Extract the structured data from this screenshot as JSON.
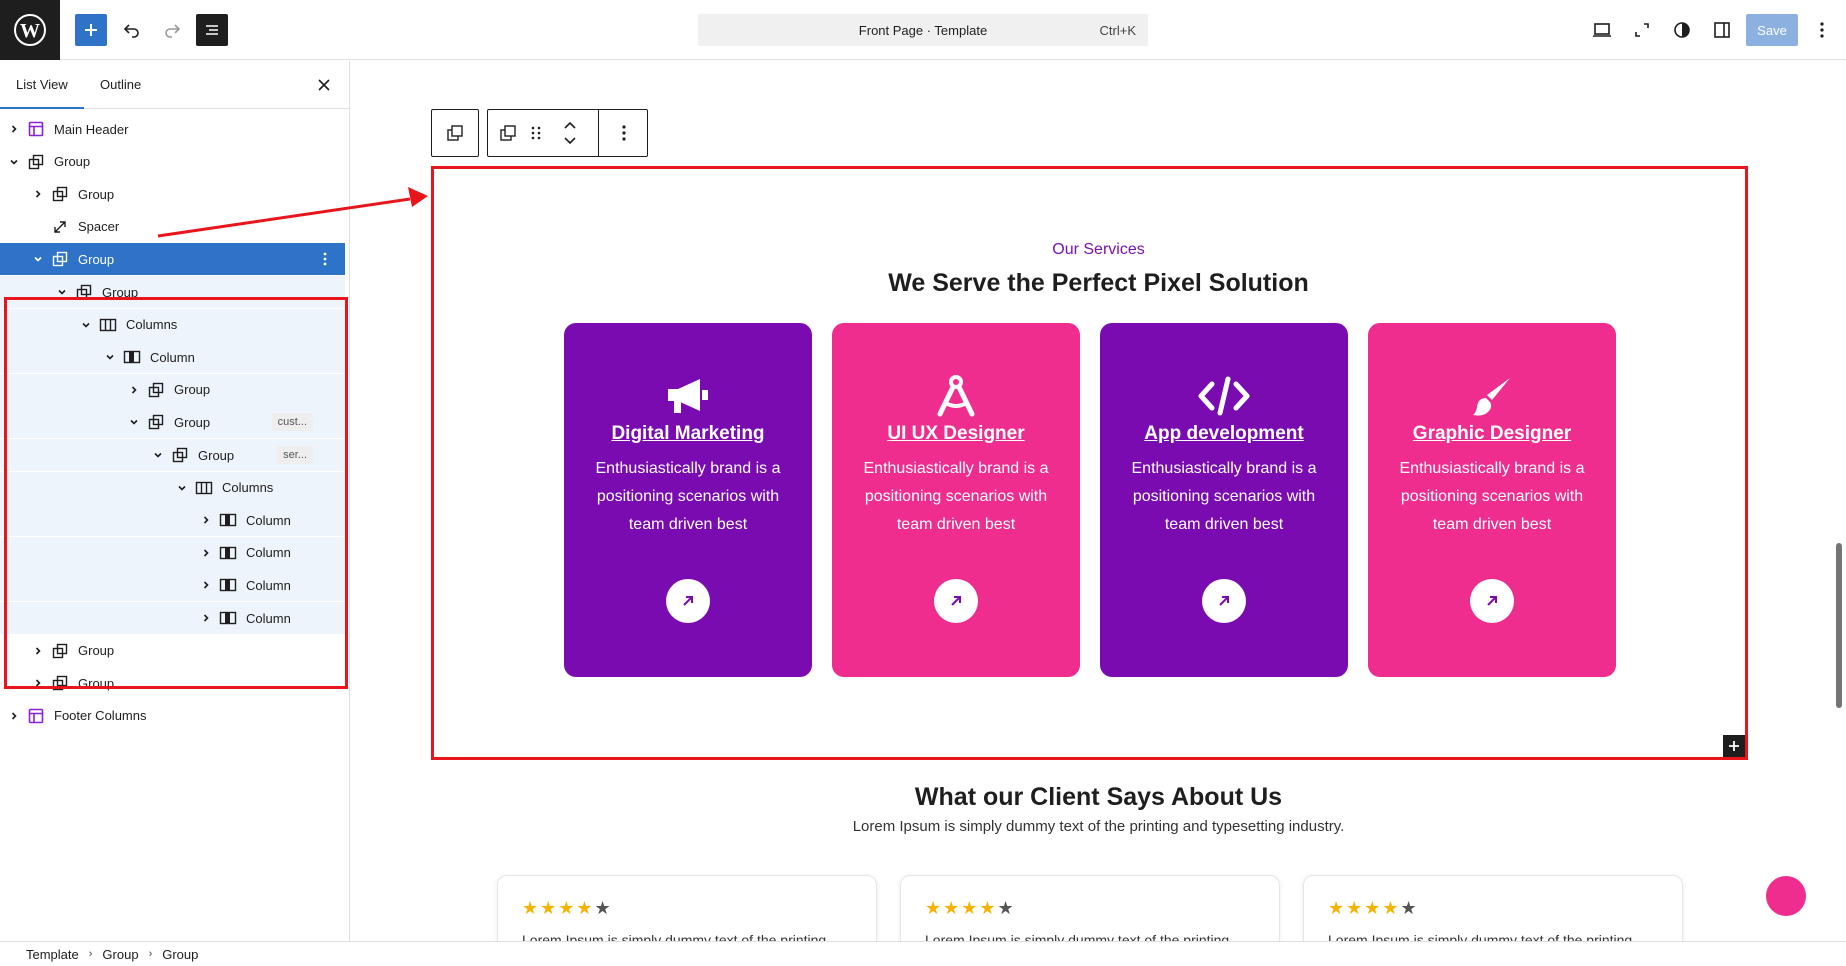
{
  "topbar": {
    "document_title": "Front Page · Template",
    "shortcut": "Ctrl+K",
    "save_label": "Save"
  },
  "sidebar": {
    "tabs": [
      {
        "label": "List View"
      },
      {
        "label": "Outline"
      }
    ],
    "rows": [
      {
        "label": "Main Header"
      },
      {
        "label": "Group"
      },
      {
        "label": "Group"
      },
      {
        "label": "Spacer"
      },
      {
        "label": "Group"
      },
      {
        "label": "Group"
      },
      {
        "label": "Columns"
      },
      {
        "label": "Column"
      },
      {
        "label": "Group"
      },
      {
        "label": "Group",
        "badge": "cust..."
      },
      {
        "label": "Group",
        "badge": "ser..."
      },
      {
        "label": "Columns"
      },
      {
        "label": "Column"
      },
      {
        "label": "Column"
      },
      {
        "label": "Column"
      },
      {
        "label": "Column"
      },
      {
        "label": "Group"
      },
      {
        "label": "Group"
      },
      {
        "label": "Footer Columns"
      }
    ]
  },
  "breadcrumb": [
    "Template",
    "Group",
    "Group"
  ],
  "services": {
    "eyebrow": "Our Services",
    "heading": "We Serve the Perfect Pixel Solution",
    "cards": [
      {
        "title": "Digital Marketing",
        "text": "Enthusiastically brand is a positioning scenarios with team driven best",
        "icon": "megaphone-icon"
      },
      {
        "title": "UI UX Designer",
        "text": "Enthusiastically brand is a positioning scenarios with team driven best",
        "icon": "compass-icon"
      },
      {
        "title": "App development",
        "text": "Enthusiastically brand is a positioning scenarios with team driven best",
        "icon": "code-icon"
      },
      {
        "title": "Graphic Designer",
        "text": "Enthusiastically brand is a positioning scenarios with team driven best",
        "icon": "brush-icon"
      }
    ],
    "colors": {
      "purple": "#7a0bb0",
      "pink": "#ee2d8f",
      "accent": "#2f73c9",
      "highlight": "#e8151d"
    }
  },
  "testimonials": {
    "heading": "What our Client Says About Us",
    "subheading": "Lorem Ipsum is simply dummy text of the printing and typesetting industry.",
    "cards": [
      {
        "rating": 4,
        "text": "Lorem Ipsum is simply dummy text of the printing"
      },
      {
        "rating": 4,
        "text": "Lorem Ipsum is simply dummy text of the printing"
      },
      {
        "rating": 4,
        "text": "Lorem Ipsum is simply dummy text of the printing"
      }
    ]
  }
}
